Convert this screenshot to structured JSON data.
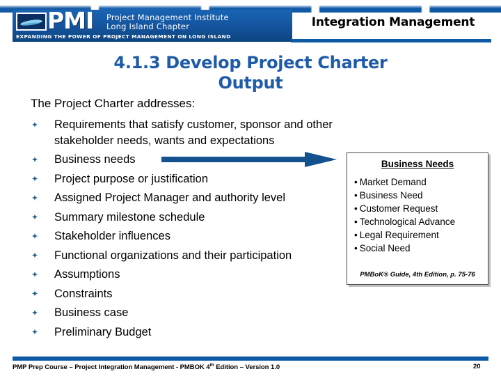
{
  "header": {
    "logo": {
      "acronym": "PMI",
      "institute_line1": "Project Management Institute",
      "institute_line2": "Long Island Chapter",
      "tagline": "EXPANDING THE POWER OF PROJECT MANAGEMENT ON LONG ISLAND"
    },
    "title": "Integration Management"
  },
  "slide": {
    "title_line1": "4.1.3 Develop Project Charter",
    "title_line2": "Output",
    "lead": "The Project Charter addresses:",
    "bullets": [
      "Requirements that satisfy customer, sponsor and other stakeholder needs, wants and expectations",
      "Business needs",
      "Project purpose or justification",
      "Assigned Project Manager and authority level",
      "Summary milestone schedule",
      "Stakeholder influences",
      "Functional organizations and their participation",
      "Assumptions",
      "Constraints",
      "Business case",
      "Preliminary Budget"
    ]
  },
  "callout": {
    "title": "Business Needs",
    "bullet_glyph": "•",
    "items": [
      "Market Demand",
      "Business Need",
      "Customer Request",
      "Technological Advance",
      "Legal Requirement",
      "Social Need"
    ],
    "citation": "PMBoK® Guide, 4th Edition, p. 75-76"
  },
  "footer": {
    "text_before": "PMP Prep Course – Project Integration Management - PMBOK 4",
    "superscript": "th",
    "text_after": " Edition – Version 1.0",
    "page_number": "20"
  },
  "colors": {
    "brand_blue": "#0d5aa7",
    "title_blue": "#1e5ba8",
    "arrow_blue": "#14528f",
    "bullet_blue": "#1f5c86"
  }
}
